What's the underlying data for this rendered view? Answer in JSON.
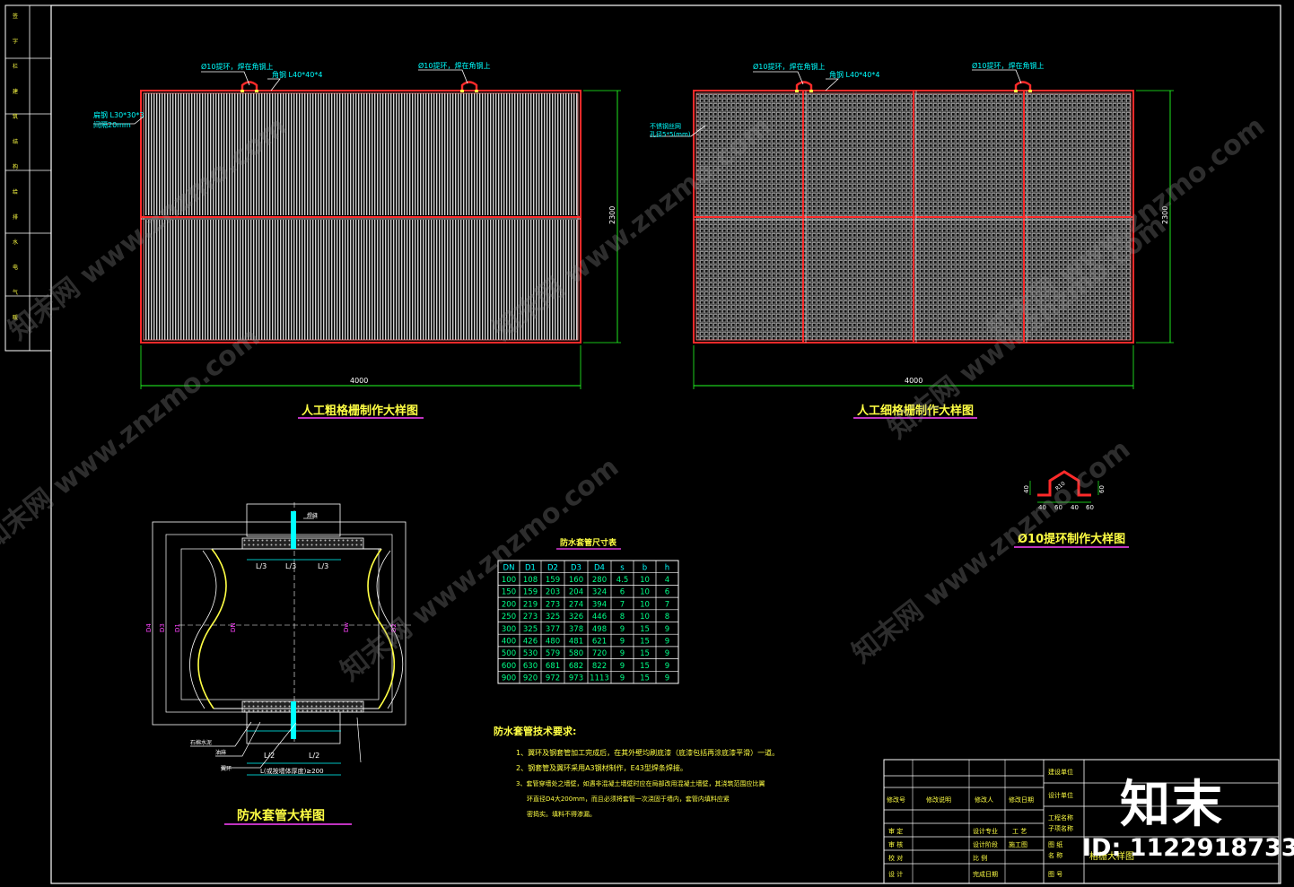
{
  "drawing": {
    "coarse_screen": {
      "title": "人工粗格栅制作大样图",
      "width": "4000",
      "height": "2300",
      "callout_hook_left": "Ø10提环，焊在角钢上",
      "callout_hook_right": "Ø10提环，焊在角钢上",
      "callout_angle_top": "角钢 L40*40*4",
      "callout_angle_side": "扁钢 L30*30*3",
      "callout_spacing": "间隔20mm"
    },
    "fine_screen": {
      "title": "人工细格栅制作大样图",
      "width": "4000",
      "height": "2300",
      "callout_hook_left": "Ø10提环，焊在角钢上",
      "callout_hook_right": "Ø10提环，焊在角钢上",
      "callout_angle_top": "角钢 L40*40*4",
      "callout_mesh": "不锈钢丝网",
      "callout_mesh_size": "孔径5*5(mm)"
    },
    "hook": {
      "title": "Ø10提环制作大样图",
      "dims": [
        "40",
        "60",
        "40",
        "60",
        "40",
        "60",
        "60",
        "R10"
      ]
    },
    "sleeve": {
      "title": "防水套管大样图",
      "labels": {
        "d1": "D1",
        "d2": "D2",
        "d3": "D3",
        "d4": "D4",
        "dn": "DN",
        "dw": "Dw",
        "l3a": "L/3",
        "l3b": "L/3",
        "l3c": "L/3",
        "l2a": "L/2",
        "l2b": "L/2",
        "bottom_dim": "L(或按墙体厚度)≥200",
        "side_a": "石棉水泥",
        "side_b": "油麻",
        "side_c": "翼环",
        "weld": "焊缝"
      }
    },
    "table": {
      "title": "防水套管尺寸表",
      "headers": [
        "DN",
        "D1",
        "D2",
        "D3",
        "D4",
        "s",
        "b",
        "h"
      ],
      "rows": [
        [
          "100",
          "108",
          "159",
          "160",
          "280",
          "4.5",
          "10",
          "4"
        ],
        [
          "150",
          "159",
          "203",
          "204",
          "324",
          "6",
          "10",
          "6"
        ],
        [
          "200",
          "219",
          "273",
          "274",
          "394",
          "7",
          "10",
          "7"
        ],
        [
          "250",
          "273",
          "325",
          "326",
          "446",
          "8",
          "10",
          "8"
        ],
        [
          "300",
          "325",
          "377",
          "378",
          "498",
          "9",
          "15",
          "9"
        ],
        [
          "400",
          "426",
          "480",
          "481",
          "621",
          "9",
          "15",
          "9"
        ],
        [
          "500",
          "530",
          "579",
          "580",
          "720",
          "9",
          "15",
          "9"
        ],
        [
          "600",
          "630",
          "681",
          "682",
          "822",
          "9",
          "15",
          "9"
        ],
        [
          "900",
          "920",
          "972",
          "973",
          "1113",
          "9",
          "15",
          "9"
        ]
      ]
    },
    "notes": {
      "title": "防水套管技术要求:",
      "items": [
        "1、翼环及钢套管加工完成后，在其外壁均刷底漆（底漆包括再涂底漆平滑）一道。",
        "2、钢套管及翼环采用A3钢材制作，E43型焊条焊接。",
        "3、套管穿墙处之墙壁，如遇非混凝土墙壁时应在局部改用混凝土墙壁，其浇筑范围应比翼",
        "环直径D4大200mm，而且必须将套管一次浇固于墙内，套管内填料应紧",
        "密捣实。填料不得渗漏。"
      ]
    },
    "title_block": {
      "r1": [
        "建设单位"
      ],
      "r2a": [
        "修改号",
        "修改说明",
        "修改人",
        "修改日期"
      ],
      "r2b": [
        "设计单位"
      ],
      "r3": [
        "工程名称",
        "子项名称"
      ],
      "r4": [
        "审 定",
        "设计专业",
        "工 艺"
      ],
      "r5": [
        "审 核",
        "设计阶段",
        "施工图",
        "图 纸"
      ],
      "r6": [
        "校 对",
        "比 例",
        "名 称"
      ],
      "r7": [
        "设 计",
        "完成日期",
        "图 号"
      ],
      "drawing_name": "格栅大样图"
    },
    "left_strip": [
      "签",
      "字",
      "栏",
      "建",
      "筑",
      "结",
      "构",
      "给",
      "排",
      "水",
      "电",
      "气",
      "暖"
    ]
  },
  "watermarks": [
    "知末网 www.znzmo.com",
    "知末网 www.znzmo.com",
    "知末网 www.znzmo.com",
    "知末网 www.znzmo.com",
    "知末网 www.znzmo.com",
    "知末网 www.znzmo.com",
    "知末网 www.znzmo.com"
  ],
  "brand": {
    "name": "知末",
    "id": "ID: 1122918733"
  },
  "colors": {
    "frame": "#ffffff",
    "red": "#ff2a2a",
    "cyan": "#00ffff",
    "green": "#22ff22",
    "yellow": "#ffff44",
    "magenta": "#ff44ff",
    "grating": "#cfcfcf"
  }
}
